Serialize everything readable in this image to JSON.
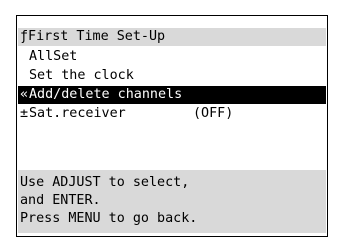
{
  "menu": {
    "title": "ƒFirst Time Set-Up",
    "items": [
      {
        "prefix": "",
        "label": "AllSet",
        "value": "",
        "selected": false
      },
      {
        "prefix": "",
        "label": "Set the clock",
        "value": "",
        "selected": false
      },
      {
        "prefix": "«",
        "label": "Add/delete channels",
        "value": "",
        "selected": true
      },
      {
        "prefix": "±",
        "label": "Sat.receiver",
        "value": "(OFF)",
        "selected": false
      }
    ]
  },
  "help": {
    "lines": [
      "Use ADJUST to select,",
      "and ENTER.",
      "Press MENU to go back."
    ]
  },
  "colors": {
    "background": "#ffffff",
    "panel": "#d9d9d9",
    "selection": "#000000",
    "text": "#000000",
    "selected_text": "#ffffff"
  }
}
